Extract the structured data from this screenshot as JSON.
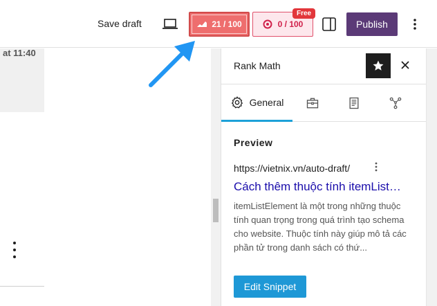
{
  "toolbar": {
    "save_draft": "Save draft",
    "seo_score": "21 / 100",
    "content_score": "0 / 100",
    "free_tag": "Free",
    "publish": "Publish"
  },
  "canvas": {
    "time_text": "at 11:40"
  },
  "panel": {
    "title": "Rank Math",
    "tabs": [
      {
        "label": "General",
        "icon": "gear-icon"
      },
      {
        "label": "",
        "icon": "toolbox-icon"
      },
      {
        "label": "",
        "icon": "document-icon"
      },
      {
        "label": "",
        "icon": "schema-icon"
      }
    ],
    "preview": {
      "heading": "Preview",
      "url": "https://vietnix.vn/auto-draft/",
      "link": "Cách thêm thuộc tính itemList…",
      "description": "itemListElement là một trong những thuộc tính quan trọng trong quá trình tạo schema cho website. Thuộc tính này giúp mô tả các phần tử trong danh sách có thứ...",
      "edit_button": "Edit Snippet"
    }
  },
  "colors": {
    "accent": "#1e98d6",
    "publish": "#5b3a77",
    "seo_badge": "#ee6e6e",
    "content_badge": "#d0204a",
    "link": "#1a0dab",
    "annotation_arrow": "#2196f3"
  }
}
